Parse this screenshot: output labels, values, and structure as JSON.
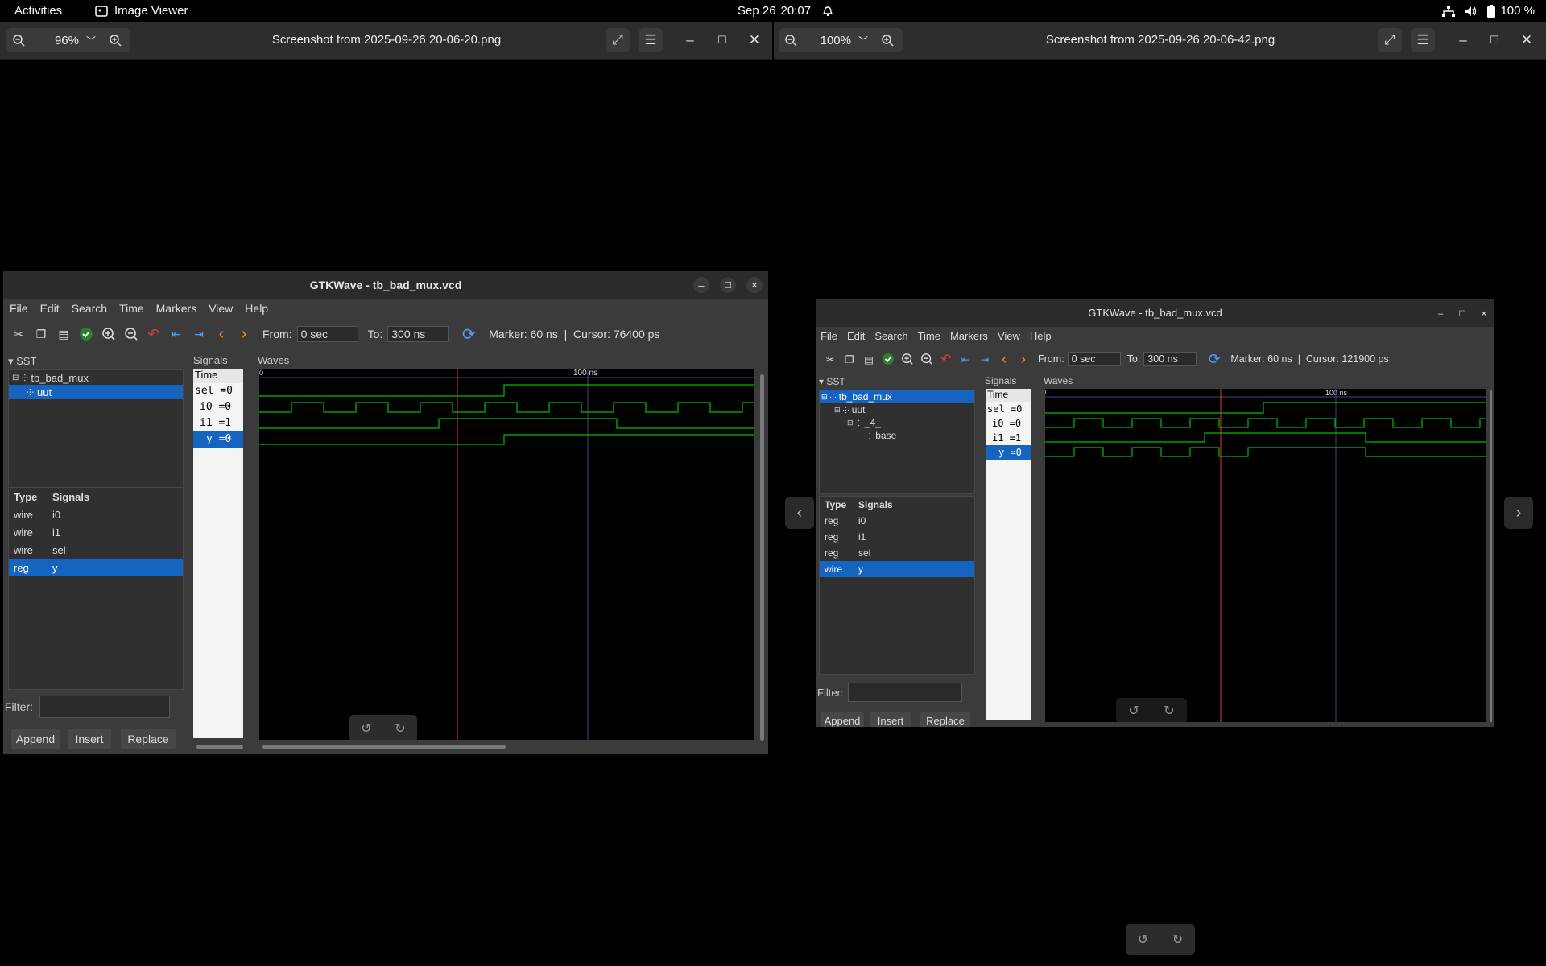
{
  "topbar": {
    "activities": "Activities",
    "app_name": "Image Viewer",
    "date": "Sep 26",
    "time": "20:07",
    "battery": "100 %"
  },
  "viewers": [
    {
      "zoom": "96%",
      "title": "Screenshot from 2025-09-26 20-06-20.png"
    },
    {
      "zoom": "100%",
      "title": "Screenshot from 2025-09-26 20-06-42.png"
    }
  ],
  "gtk": [
    {
      "title": "GTKWave - tb_bad_mux.vcd",
      "menu": [
        "File",
        "Edit",
        "Search",
        "Time",
        "Markers",
        "View",
        "Help"
      ],
      "from_label": "From:",
      "from": "0 sec",
      "to_label": "To:",
      "to": "300 ns",
      "status": "Marker: 60 ns  |  Cursor: 76400 ps",
      "sst_label": "SST",
      "tree": [
        "tb_bad_mux",
        "uut"
      ],
      "type_header": "Type",
      "signals_header": "Signals",
      "type_rows": [
        {
          "type": "wire",
          "name": "i0"
        },
        {
          "type": "wire",
          "name": "i1"
        },
        {
          "type": "wire",
          "name": "sel"
        },
        {
          "type": "reg",
          "name": "y"
        }
      ],
      "filter_label": "Filter:",
      "buttons": [
        "Append",
        "Insert",
        "Replace"
      ],
      "signals_label": "Signals",
      "waves_label": "Waves",
      "signal_list": [
        "Time",
        "sel =0",
        "i0 =0",
        "i1 =1",
        "y =0"
      ],
      "time_tick": "100 ns",
      "time_start": "0"
    },
    {
      "title": "GTKWave - tb_bad_mux.vcd",
      "menu": [
        "File",
        "Edit",
        "Search",
        "Time",
        "Markers",
        "View",
        "Help"
      ],
      "from_label": "From:",
      "from": "0 sec",
      "to_label": "To:",
      "to": "300 ns",
      "status": "Marker: 60 ns  |  Cursor: 121900 ps",
      "sst_label": "SST",
      "tree": [
        "tb_bad_mux",
        "uut",
        "_4_",
        "base"
      ],
      "type_header": "Type",
      "signals_header": "Signals",
      "type_rows": [
        {
          "type": "reg",
          "name": "i0"
        },
        {
          "type": "reg",
          "name": "i1"
        },
        {
          "type": "reg",
          "name": "sel"
        },
        {
          "type": "wire",
          "name": "y"
        }
      ],
      "filter_label": "Filter:",
      "buttons": [
        "Append",
        "Insert",
        "Replace"
      ],
      "signals_label": "Signals",
      "waves_label": "Waves",
      "signal_list": [
        "Time",
        "sel =0",
        "i0 =0",
        "i1 =1",
        "y =0"
      ],
      "time_tick": "100 ns",
      "time_start": "0"
    }
  ],
  "colors": {
    "wave": "#00c000",
    "marker": "#e53935",
    "cursor": "#4444aa",
    "selection": "#1565c0"
  },
  "icons": [
    "image-icon",
    "alarm-icon",
    "network-icon",
    "volume-icon",
    "battery-icon",
    "zoom-out-icon",
    "zoom-in-icon",
    "chevron-down-icon",
    "fullscreen-icon",
    "menu-icon",
    "minimize-icon",
    "maximize-icon",
    "close-icon",
    "rotate-left-icon",
    "rotate-right-icon"
  ]
}
